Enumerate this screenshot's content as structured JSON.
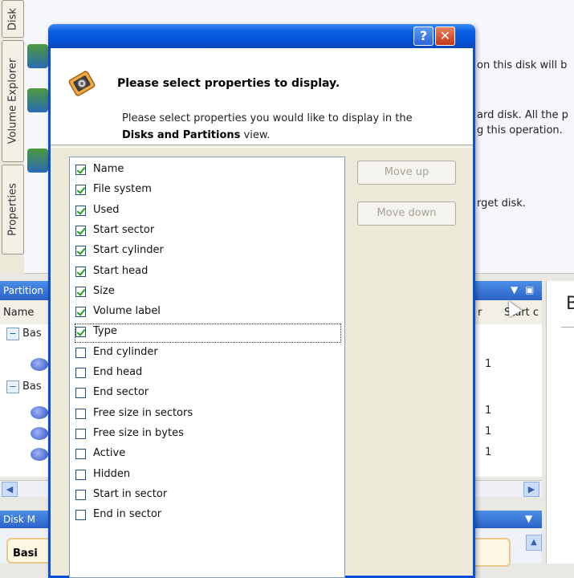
{
  "side_tabs": [
    {
      "label": "Disk"
    },
    {
      "label": "Volume Explorer"
    },
    {
      "label": "Properties"
    }
  ],
  "background": {
    "snippets": [
      "on this disk will b",
      "ard disk. All the p",
      "g this operation.",
      "rget disk."
    ],
    "partitions_panel": {
      "title": "Partition",
      "col_name": "Name",
      "col_sector": "r",
      "col_start": "Start c",
      "rows": [
        {
          "name": "Bas",
          "value": ""
        },
        {
          "name": "",
          "value": "1"
        },
        {
          "name": "Bas",
          "value": ""
        },
        {
          "name": "",
          "value": "1"
        },
        {
          "name": "",
          "value": "1"
        },
        {
          "name": "",
          "value": "1"
        }
      ]
    },
    "disk_map_title": "Disk M",
    "disk_map_basic": "Basi",
    "right_panel_letter": "B"
  },
  "dialog": {
    "help_label": "?",
    "close_label": "✕",
    "title": "Please select properties to display.",
    "description_prefix": "Please select properties you would like to display in the",
    "description_bold": "Disks and Partitions",
    "description_suffix": "view.",
    "icon": "settings-properties-icon",
    "move_up_label": "Move up",
    "move_down_label": "Move down",
    "properties": [
      {
        "label": "Name",
        "checked": true
      },
      {
        "label": "File system",
        "checked": true
      },
      {
        "label": "Used",
        "checked": true
      },
      {
        "label": "Start sector",
        "checked": true
      },
      {
        "label": "Start cylinder",
        "checked": true
      },
      {
        "label": "Start head",
        "checked": true
      },
      {
        "label": "Size",
        "checked": true
      },
      {
        "label": "Volume label",
        "checked": true
      },
      {
        "label": "Type",
        "checked": true
      },
      {
        "label": "End cylinder",
        "checked": false
      },
      {
        "label": "End head",
        "checked": false
      },
      {
        "label": "End sector",
        "checked": false
      },
      {
        "label": "Free size in sectors",
        "checked": false
      },
      {
        "label": "Free size in bytes",
        "checked": false
      },
      {
        "label": "Active",
        "checked": false
      },
      {
        "label": "Hidden",
        "checked": false
      },
      {
        "label": "Start in sector",
        "checked": false
      },
      {
        "label": "End in sector",
        "checked": false
      }
    ]
  },
  "colors": {
    "titlebar": "#0553d8",
    "check": "#21a121",
    "panel_header": "#2b63c9"
  }
}
